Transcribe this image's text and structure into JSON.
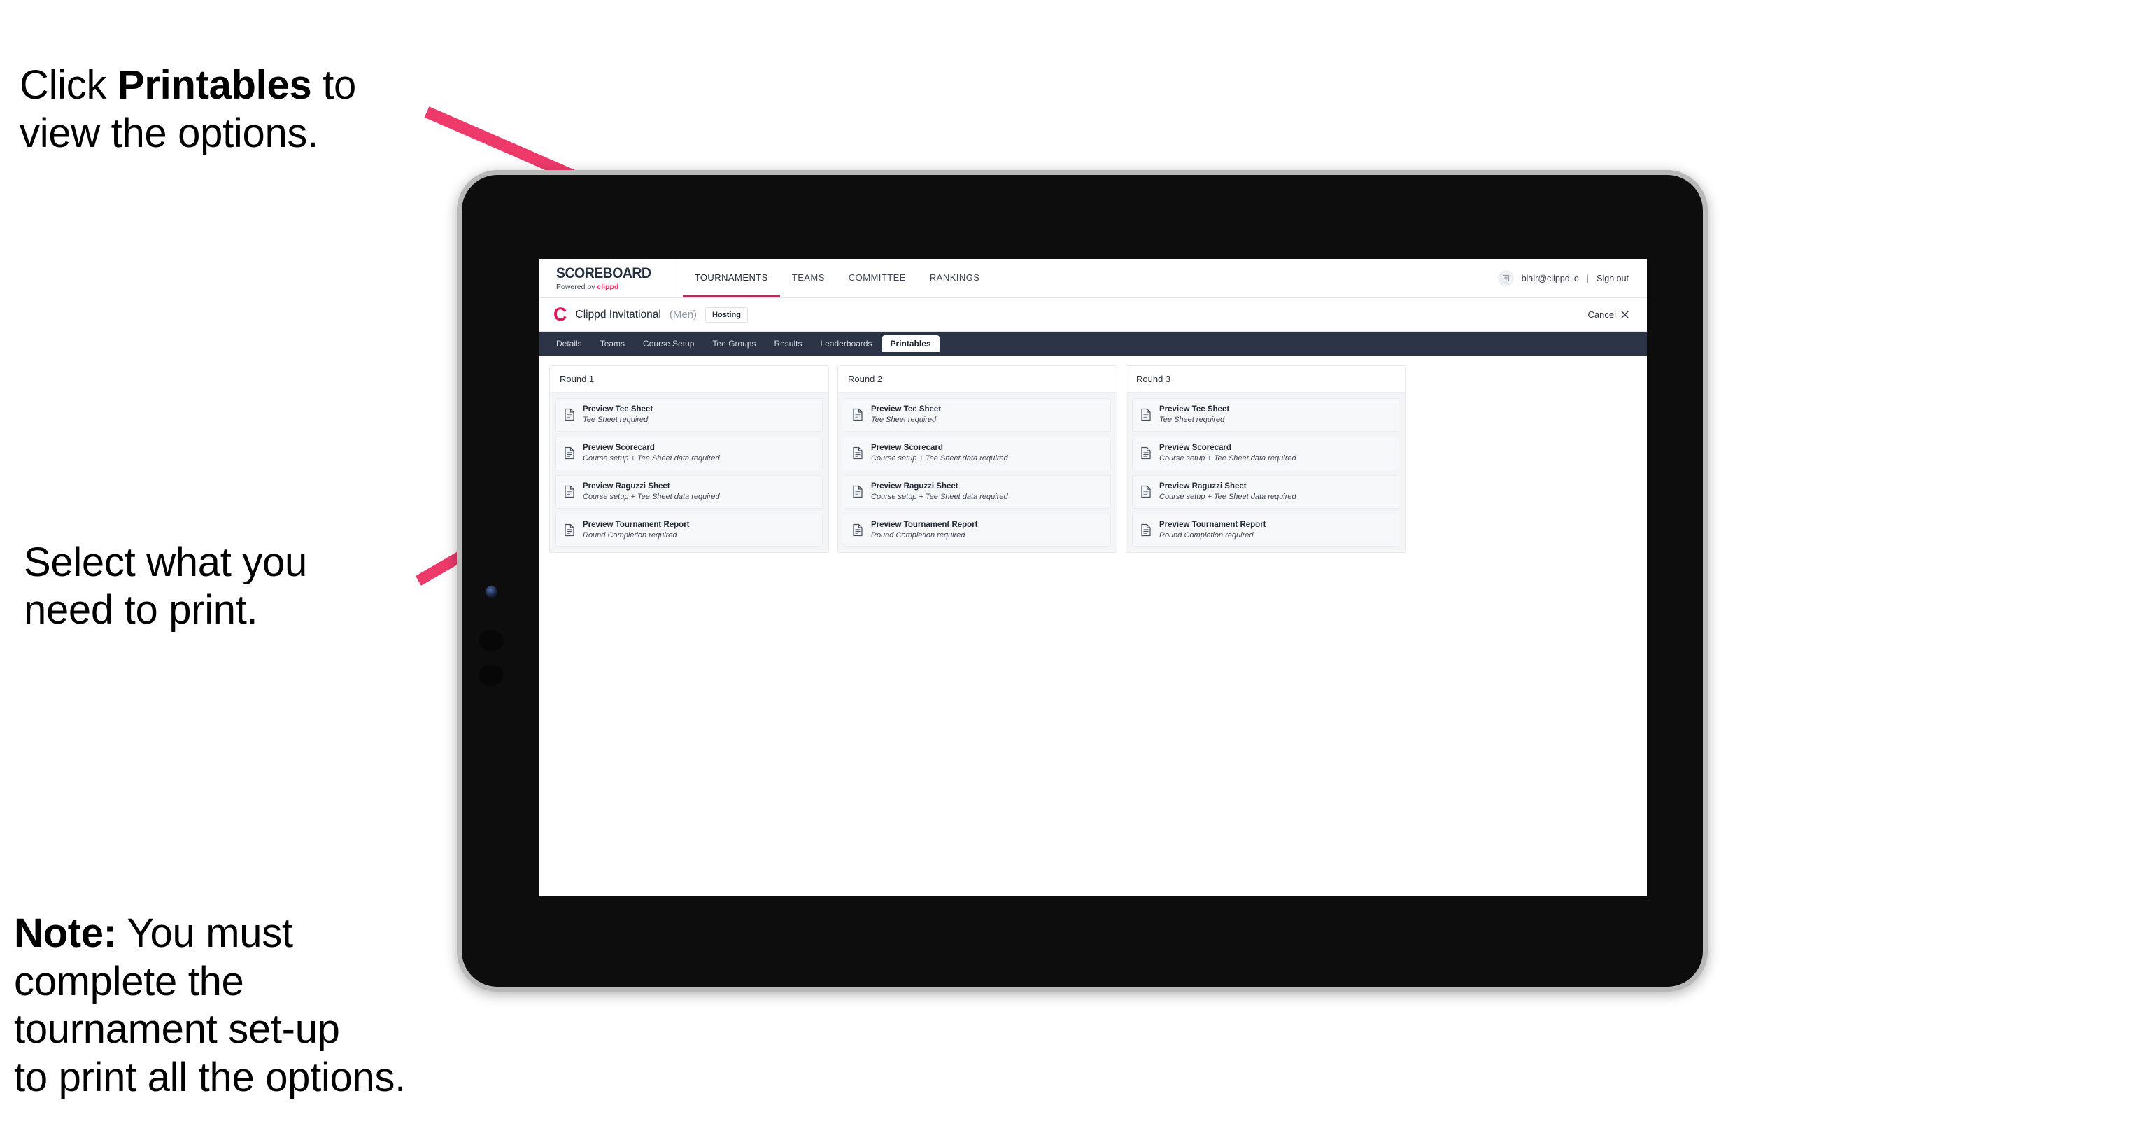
{
  "annotations": {
    "printables_hint": {
      "prefix": "Click ",
      "bold": "Printables",
      "suffix": " to\nview the options."
    },
    "select_hint": "Select what you\n need to print.",
    "note": {
      "bold": "Note:",
      "text": " You must\ncomplete the\ntournament set-up\nto print all the options."
    }
  },
  "browser": {
    "appbar": {
      "brand": {
        "wordmark": "SCOREBOARD",
        "tagline_prefix": "Powered by ",
        "tagline_brand": "clippd"
      },
      "nav": [
        {
          "label": "TOURNAMENTS",
          "active": true
        },
        {
          "label": "TEAMS",
          "active": false
        },
        {
          "label": "COMMITTEE",
          "active": false
        },
        {
          "label": "RANKINGS",
          "active": false
        }
      ],
      "user": {
        "avatar_icon": "user-avatar-icon",
        "email": "blair@clippd.io",
        "separator": "|",
        "signout_label": "Sign out"
      }
    },
    "titlebar": {
      "logo_letter": "C",
      "tournament_name": "Clippd Invitational",
      "gender": "(Men)",
      "hosting_badge": "Hosting",
      "cancel_label": "Cancel",
      "cancel_icon": "close-icon"
    },
    "subtabs": [
      {
        "label": "Details",
        "active": false
      },
      {
        "label": "Teams",
        "active": false
      },
      {
        "label": "Course Setup",
        "active": false
      },
      {
        "label": "Tee Groups",
        "active": false
      },
      {
        "label": "Results",
        "active": false
      },
      {
        "label": "Leaderboards",
        "active": false
      },
      {
        "label": "Printables",
        "active": true
      }
    ],
    "rounds": [
      {
        "title": "Round 1",
        "items": [
          {
            "title": "Preview Tee Sheet",
            "sub": "Tee Sheet required"
          },
          {
            "title": "Preview Scorecard",
            "sub": "Course setup + Tee Sheet data required"
          },
          {
            "title": "Preview Raguzzi Sheet",
            "sub": "Course setup + Tee Sheet data required"
          },
          {
            "title": "Preview Tournament Report",
            "sub": "Round Completion required"
          }
        ]
      },
      {
        "title": "Round 2",
        "items": [
          {
            "title": "Preview Tee Sheet",
            "sub": "Tee Sheet required"
          },
          {
            "title": "Preview Scorecard",
            "sub": "Course setup + Tee Sheet data required"
          },
          {
            "title": "Preview Raguzzi Sheet",
            "sub": "Course setup + Tee Sheet data required"
          },
          {
            "title": "Preview Tournament Report",
            "sub": "Round Completion required"
          }
        ]
      },
      {
        "title": "Round 3",
        "items": [
          {
            "title": "Preview Tee Sheet",
            "sub": "Tee Sheet required"
          },
          {
            "title": "Preview Scorecard",
            "sub": "Course setup + Tee Sheet data required"
          },
          {
            "title": "Preview Raguzzi Sheet",
            "sub": "Course setup + Tee Sheet data required"
          },
          {
            "title": "Preview Tournament Report",
            "sub": "Round Completion required"
          }
        ]
      }
    ]
  },
  "colors": {
    "arrow_pink": "#EE3A6B",
    "brand_pink": "#E2145C",
    "subtab_bar": "#2B3446",
    "nav_active_underline": "#B03055",
    "device_bezel": "#B9B9B9",
    "device_body": "#0D0D0D"
  }
}
